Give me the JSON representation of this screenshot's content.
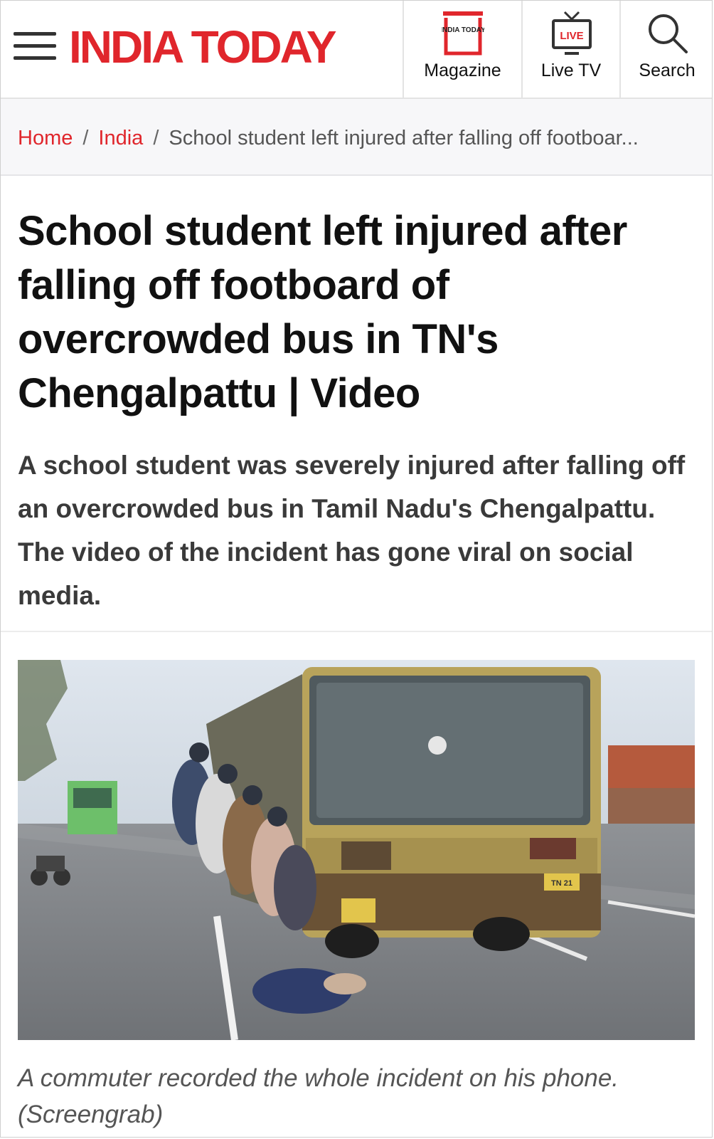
{
  "header": {
    "brand": "INDIA TODAY",
    "brand_color": "#e0262c",
    "nav": [
      {
        "label": "Magazine",
        "icon": "magazine-icon",
        "icon_text": "INDIA TODAY"
      },
      {
        "label": "Live TV",
        "icon": "live-tv-icon",
        "icon_text": "LIVE"
      },
      {
        "label": "Search",
        "icon": "search-icon"
      }
    ]
  },
  "breadcrumb": {
    "home": "Home",
    "section": "India",
    "current": "School student left injured after falling off footboar...",
    "link_color": "#e0262c"
  },
  "article": {
    "headline": "School student left injured after falling off footboard of overcrowded bus in TN's Chengalpattu | Video",
    "summary": "A school student was severely injured after falling off an overcrowded bus in Tamil Nadu's Chengalpattu. The video of the incident has gone viral on social media.",
    "image": {
      "plate_text": "TN 21"
    },
    "caption": "A commuter recorded the whole incident on his phone. (Screengrab)"
  }
}
